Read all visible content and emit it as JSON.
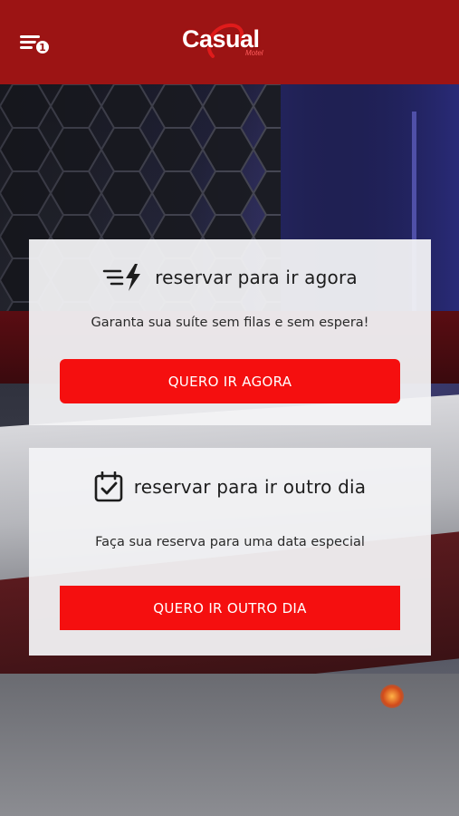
{
  "header": {
    "menu_icon": "hamburger-menu-icon",
    "notification_count": "1",
    "logo_text": "Casual",
    "logo_sub": "Motel",
    "background_color": "#9c1414"
  },
  "options": [
    {
      "icon": "lightning-speed-icon",
      "title": "reservar para ir agora",
      "description": "Garanta sua suíte sem filas e sem espera!",
      "button_label": "QUERO IR AGORA"
    },
    {
      "icon": "calendar-check-icon",
      "title": "reservar para ir outro dia",
      "description": "Faça sua reserva para uma data especial",
      "button_label": "QUERO IR OUTRO DIA"
    }
  ],
  "colors": {
    "accent": "#f50f0f",
    "header": "#9c1414",
    "card_bg": "#f3f3f5"
  }
}
